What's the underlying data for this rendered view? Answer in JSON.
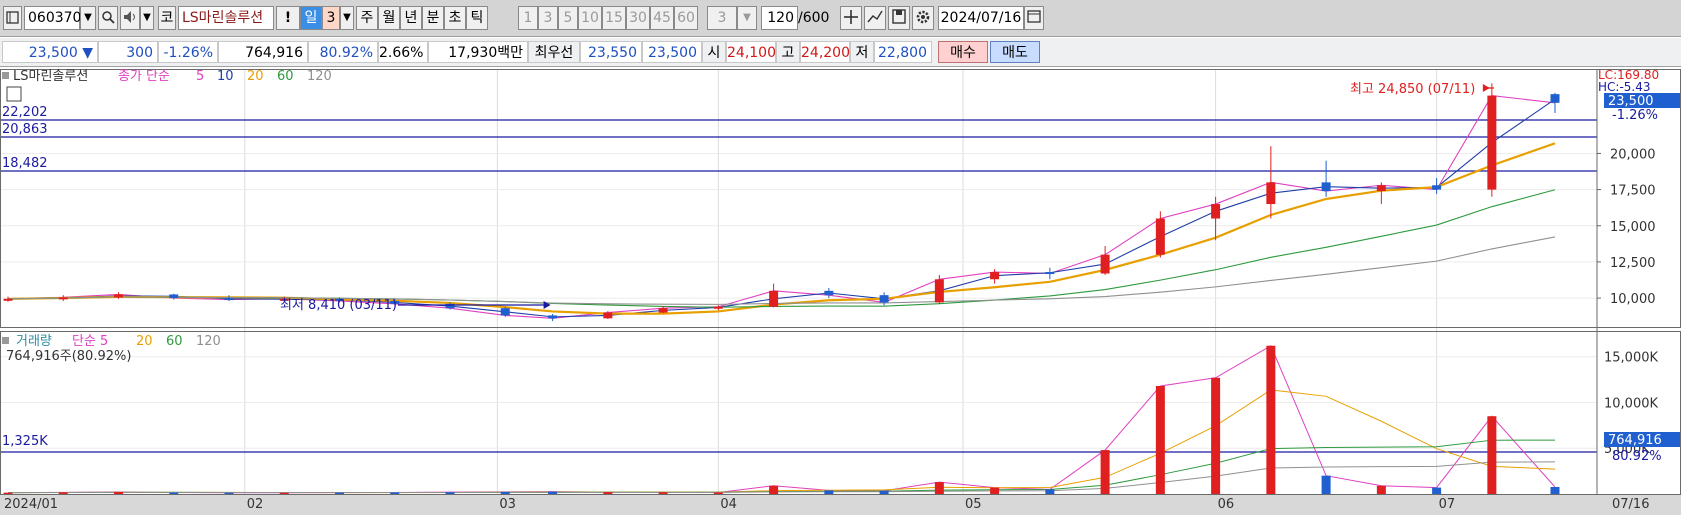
{
  "toolbar": {
    "code": "060370",
    "market": "코",
    "name": "LS마린솔루션",
    "alert": "!",
    "periods": [
      {
        "label": "일",
        "state": "sel"
      },
      {
        "label": "3",
        "state": "peach"
      },
      {
        "label": "주",
        "state": "norm"
      },
      {
        "label": "월",
        "state": "norm"
      },
      {
        "label": "년",
        "state": "norm"
      },
      {
        "label": "분",
        "state": "norm"
      },
      {
        "label": "초",
        "state": "norm"
      },
      {
        "label": "틱",
        "state": "norm"
      }
    ],
    "intervals": [
      "1",
      "3",
      "5",
      "10",
      "15",
      "30",
      "45",
      "60"
    ],
    "interval_select": "3",
    "count": "120",
    "count_total": "/600",
    "date": "2024/07/16"
  },
  "info": {
    "price": "23,500",
    "arrow": "▼",
    "change": "300",
    "change_pct": "-1.26%",
    "volume": "764,916",
    "vol_ratio": "80.92%",
    "turnover": "2.66%",
    "amount": "17,930백만",
    "best_label": "최우선",
    "ask": "23,550",
    "bid": "23,500",
    "open_label": "시",
    "open": "24,100",
    "high_label": "고",
    "high": "24,200",
    "low_label": "저",
    "low": "22,800",
    "buy_button": "매수",
    "sell_button": "매도"
  },
  "price_panel": {
    "legend_name": "LS마린솔루션",
    "legend_ma_label": "종가 단순",
    "ma_periods": [
      {
        "label": "5",
        "color": "#e040c0"
      },
      {
        "label": "10",
        "color": "#1f3fa8"
      },
      {
        "label": "20",
        "color": "#e8a000"
      },
      {
        "label": "60",
        "color": "#2e9a3e"
      },
      {
        "label": "120",
        "color": "#909090"
      }
    ],
    "hlines": [
      {
        "label": "22,202",
        "value": 22202
      },
      {
        "label": "20,863",
        "value": 20863
      },
      {
        "label": "18,482",
        "value": 18482
      }
    ],
    "max_annotation": "최고 24,850 (07/11)",
    "min_annotation": "최저 8,410 (03/11)",
    "lc_label": "LC:169.80",
    "hc_label": "HC:-5.43",
    "current_price_tag": "23,500",
    "current_pct_tag": "-1.26%",
    "y_ticks": [
      "20,000",
      "17,500",
      "15,000",
      "12,500",
      "10,000"
    ],
    "colors": {
      "up": "#e02020",
      "down": "#1f5fd0",
      "hline": "#1a1aa0"
    }
  },
  "volume_panel": {
    "legend_name": "거래량",
    "legend_ma_label": "단순 5",
    "ma_periods": [
      {
        "label": "20",
        "color": "#e8a000"
      },
      {
        "label": "60",
        "color": "#2e9a3e"
      },
      {
        "label": "120",
        "color": "#909090"
      }
    ],
    "vol_text": "764,916주(80.92%)",
    "hline_label": "1,325K",
    "y_ticks": [
      "15,000K",
      "10,000K",
      "5,000K"
    ],
    "current_volume_tag": "764,916",
    "current_pct_tag": "80.92%"
  },
  "x_axis": {
    "labels": [
      "2024/01",
      "02",
      "03",
      "04",
      "05",
      "06",
      "07"
    ],
    "end_label": "07/16"
  },
  "chart_data": {
    "type": "candlestick",
    "ylim": [
      8000,
      25700
    ],
    "volume_ylim": [
      0,
      16500000
    ],
    "candles": [
      {
        "x": "2024/01/02",
        "o": 9880,
        "h": 10100,
        "l": 9750,
        "c": 9950,
        "v": 150000
      },
      {
        "x": "2024/01/09",
        "o": 9950,
        "h": 10200,
        "l": 9800,
        "c": 10050,
        "v": 180000
      },
      {
        "x": "2024/01/16",
        "o": 10050,
        "h": 10400,
        "l": 9950,
        "c": 10250,
        "v": 220000
      },
      {
        "x": "2024/01/23",
        "o": 10250,
        "h": 10300,
        "l": 9900,
        "c": 10000,
        "v": 160000
      },
      {
        "x": "2024/01/30",
        "o": 10000,
        "h": 10200,
        "l": 9800,
        "c": 9900,
        "v": 140000
      },
      {
        "x": "2024/02/06",
        "o": 9900,
        "h": 10100,
        "l": 9750,
        "c": 9950,
        "v": 130000
      },
      {
        "x": "2024/02/13",
        "o": 9950,
        "h": 10050,
        "l": 9700,
        "c": 9800,
        "v": 150000
      },
      {
        "x": "2024/02/20",
        "o": 9800,
        "h": 9950,
        "l": 9500,
        "c": 9600,
        "v": 170000
      },
      {
        "x": "2024/02/27",
        "o": 9600,
        "h": 9700,
        "l": 9200,
        "c": 9300,
        "v": 200000
      },
      {
        "x": "2024/03/05",
        "o": 9300,
        "h": 9400,
        "l": 8700,
        "c": 8800,
        "v": 230000
      },
      {
        "x": "2024/03/11",
        "o": 8800,
        "h": 8900,
        "l": 8410,
        "c": 8600,
        "v": 260000
      },
      {
        "x": "2024/03/18",
        "o": 8600,
        "h": 9100,
        "l": 8550,
        "c": 9000,
        "v": 210000
      },
      {
        "x": "2024/03/25",
        "o": 9000,
        "h": 9450,
        "l": 8950,
        "c": 9300,
        "v": 190000
      },
      {
        "x": "2024/04/01",
        "o": 9300,
        "h": 9500,
        "l": 9150,
        "c": 9400,
        "v": 170000
      },
      {
        "x": "2024/04/08",
        "o": 9400,
        "h": 11000,
        "l": 9350,
        "c": 10500,
        "v": 900000
      },
      {
        "x": "2024/04/15",
        "o": 10500,
        "h": 10700,
        "l": 10000,
        "c": 10200,
        "v": 400000
      },
      {
        "x": "2024/04/22",
        "o": 10200,
        "h": 10400,
        "l": 9500,
        "c": 9700,
        "v": 350000
      },
      {
        "x": "2024/04/29",
        "o": 9700,
        "h": 11600,
        "l": 9600,
        "c": 11300,
        "v": 1300000
      },
      {
        "x": "2024/05/06",
        "o": 11300,
        "h": 12000,
        "l": 11000,
        "c": 11800,
        "v": 700000
      },
      {
        "x": "2024/05/13",
        "o": 11800,
        "h": 12100,
        "l": 11300,
        "c": 11700,
        "v": 500000
      },
      {
        "x": "2024/05/20",
        "o": 11700,
        "h": 13600,
        "l": 11600,
        "c": 13000,
        "v": 4800000
      },
      {
        "x": "2024/05/27",
        "o": 13000,
        "h": 16000,
        "l": 12800,
        "c": 15500,
        "v": 11800000
      },
      {
        "x": "2024/06/03",
        "o": 15500,
        "h": 17000,
        "l": 14000,
        "c": 16500,
        "v": 12700000
      },
      {
        "x": "2024/06/10",
        "o": 16500,
        "h": 20500,
        "l": 15500,
        "c": 18000,
        "v": 16200000
      },
      {
        "x": "2024/06/17",
        "o": 18000,
        "h": 19500,
        "l": 17000,
        "c": 17400,
        "v": 2000000
      },
      {
        "x": "2024/06/24",
        "o": 17400,
        "h": 18000,
        "l": 16500,
        "c": 17800,
        "v": 900000
      },
      {
        "x": "2024/07/01",
        "o": 17800,
        "h": 18300,
        "l": 17200,
        "c": 17500,
        "v": 700000
      },
      {
        "x": "2024/07/08",
        "o": 17500,
        "h": 24850,
        "l": 17000,
        "c": 24000,
        "v": 8500000
      },
      {
        "x": "2024/07/16",
        "o": 24100,
        "h": 24200,
        "l": 22800,
        "c": 23500,
        "v": 764916
      }
    ]
  }
}
